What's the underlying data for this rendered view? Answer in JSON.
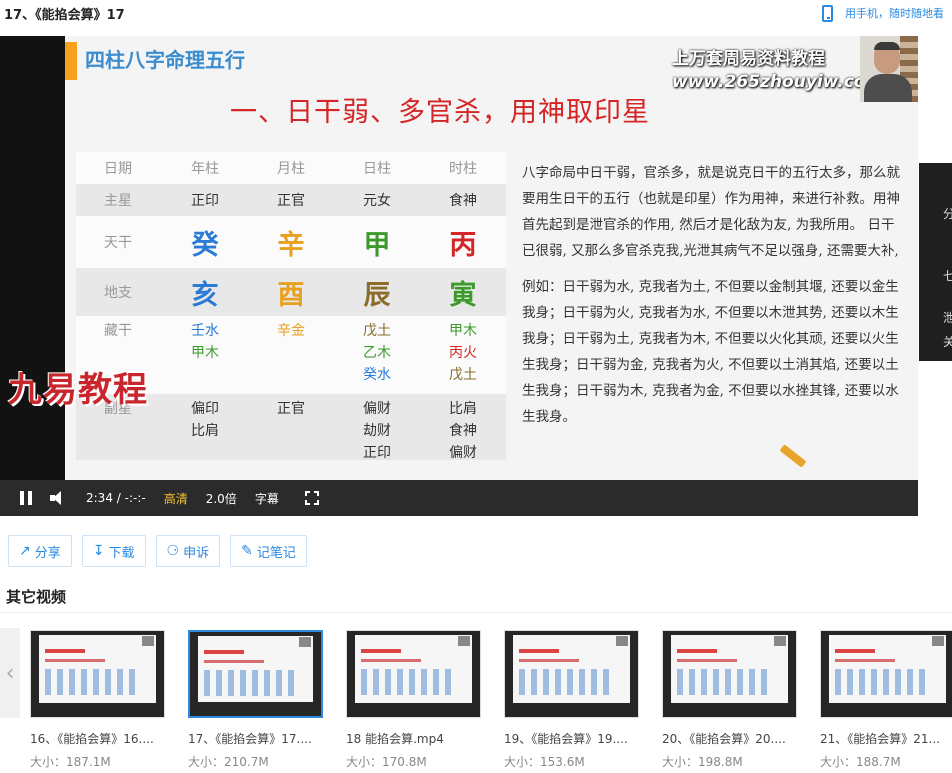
{
  "header": {
    "title": "17、《能掐会算》17",
    "mobile_text": "用手机，随时随地看"
  },
  "slide": {
    "heading": "四柱八字命理五行",
    "watermark_line1": "上万套周易资料教程",
    "watermark_line2": "www.265zhouyiw.com",
    "title": "一、日干弱、多官杀，用神取印星",
    "table": {
      "headers": [
        "日期",
        "年柱",
        "月柱",
        "日柱",
        "时柱"
      ],
      "zhuxing": {
        "label": "主星",
        "values": [
          "正印",
          "正官",
          "元女",
          "食神"
        ]
      },
      "tiangan": {
        "label": "天干",
        "values": [
          "癸",
          "辛",
          "甲",
          "丙"
        ],
        "colors": [
          "#2b7bd6",
          "#e8a020",
          "#3a9a2a",
          "#d42626"
        ],
        "icons": [
          "water-drops-icon",
          "metal-icon",
          "wood-icon",
          "fire-icon"
        ]
      },
      "dizhi": {
        "label": "地支",
        "values": [
          "亥",
          "酉",
          "辰",
          "寅"
        ],
        "colors": [
          "#2b7bd6",
          "#e8a020",
          "#8a6d2a",
          "#3a9a2a"
        ],
        "icons": [
          "water-drops-icon",
          "metal-icon",
          "earth-icon",
          "wood-icon"
        ]
      },
      "canggan": {
        "label": "藏干",
        "values": [
          [
            "壬水",
            "甲木"
          ],
          [
            "辛金"
          ],
          [
            "戊土",
            "乙木",
            "癸水"
          ],
          [
            "甲木",
            "丙火",
            "戊土"
          ]
        ]
      },
      "fuxing": {
        "label": "副星",
        "values": [
          [
            "偏印",
            "比肩"
          ],
          [
            "正官"
          ],
          [
            "偏财",
            "劫财",
            "正印"
          ],
          [
            "比肩",
            "食神",
            "偏财"
          ]
        ]
      }
    },
    "paragraph1": "八字命局中日干弱，官杀多，就是说克日干的五行太多，那么就要用生日干的五行（也就是印星）作为用神，来进行补救。用神首先起到是泄官杀的作用, 然后才是化敌为友, 为我所用。 日干已很弱, 又那么多官杀克我,光泄其病气不足以强身, 还需要大补,",
    "paragraph2": "例如：日干弱为水, 克我者为土, 不但要以金制其堰, 还要以金生我身；日干弱为火, 克我者为水, 不但要以木泄其势, 还要以木生我身；日干弱为土, 克我者为木, 不但要以火化其顽, 还要以火生生我身；日干弱为金, 克我者为火, 不但要以土消其焰, 还要以土生我身；日干弱为木, 克我者为金, 不但要以水挫其锋, 还要以水生我身。",
    "logo": "九易教程"
  },
  "player": {
    "time": "2:34 / -:-:-",
    "quality": "高清",
    "speed": "2.0倍",
    "subtitle": "字幕"
  },
  "side_panel": {
    "chars": [
      "分",
      "七",
      "泄",
      "关"
    ]
  },
  "actions": [
    {
      "label": "分享",
      "icon": "share-icon"
    },
    {
      "label": "下载",
      "icon": "download-icon"
    },
    {
      "label": "申诉",
      "icon": "megaphone-icon"
    },
    {
      "label": "记笔记",
      "icon": "pen-icon"
    }
  ],
  "other_videos": {
    "title": "其它视频",
    "items": [
      {
        "name": "16、《能掐会算》16....",
        "size": "大小：187.1M",
        "selected": false
      },
      {
        "name": "17、《能掐会算》17....",
        "size": "大小：210.7M",
        "selected": true
      },
      {
        "name": "18 能掐会算.mp4",
        "size": "大小：170.8M",
        "selected": false
      },
      {
        "name": "19、《能掐会算》19....",
        "size": "大小：153.6M",
        "selected": false
      },
      {
        "name": "20、《能掐会算》20....",
        "size": "大小：198.8M",
        "selected": false
      },
      {
        "name": "21、《能掐会算》21...",
        "size": "大小：188.7M",
        "selected": false
      }
    ]
  },
  "colors": {
    "accent": "#2a8ae0",
    "title_red": "#d42626",
    "heading_blue": "#3a8ccf",
    "hd_yellow": "#f6c22c"
  }
}
